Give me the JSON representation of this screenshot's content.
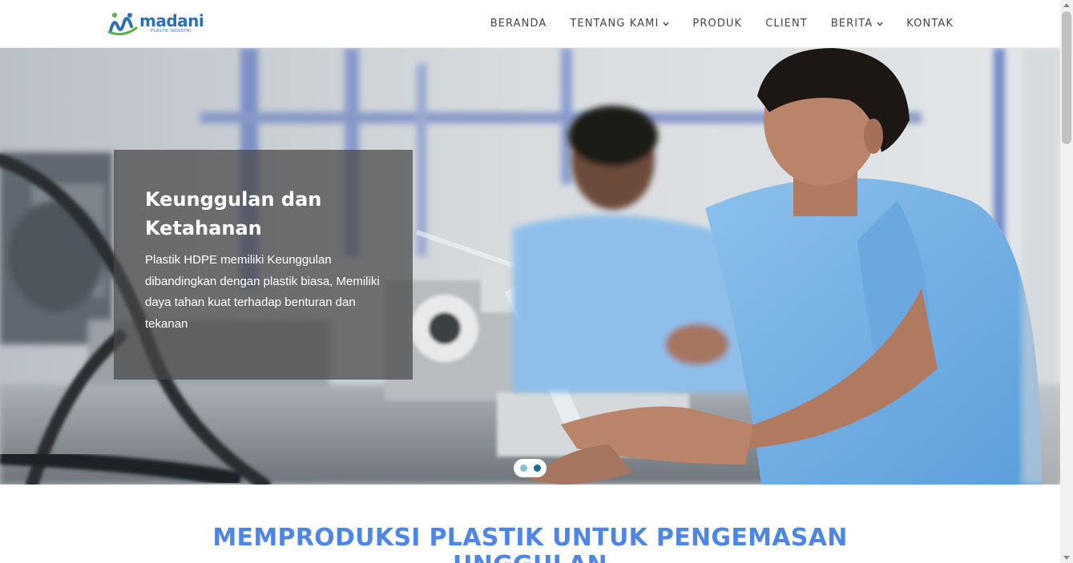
{
  "logo": {
    "word": "madani",
    "subtitle": "PLASTIK INDUSTRI",
    "color": "#2d6fb6"
  },
  "nav": {
    "items": [
      {
        "label": "BERANDA",
        "has_dropdown": false
      },
      {
        "label": "TENTANG KAMI",
        "has_dropdown": true
      },
      {
        "label": "PRODUK",
        "has_dropdown": false
      },
      {
        "label": "CLIENT",
        "has_dropdown": false
      },
      {
        "label": "BERITA",
        "has_dropdown": true
      },
      {
        "label": "KONTAK",
        "has_dropdown": false
      }
    ]
  },
  "hero": {
    "caption_title": "Keunggulan dan Ketahanan",
    "caption_body": "Plastik HDPE memiliki Keunggulan dibandingkan dengan plastik biasa, Memiliki daya tahan kuat terhadap benturan dan tekanan",
    "slides_total": 2,
    "active_slide": 2
  },
  "section": {
    "title_line1": "MEMPRODUKSI PLASTIK UNTUK PENGEMASAN",
    "title_line2": "UNGGULAN",
    "color": "#4d86e8"
  }
}
